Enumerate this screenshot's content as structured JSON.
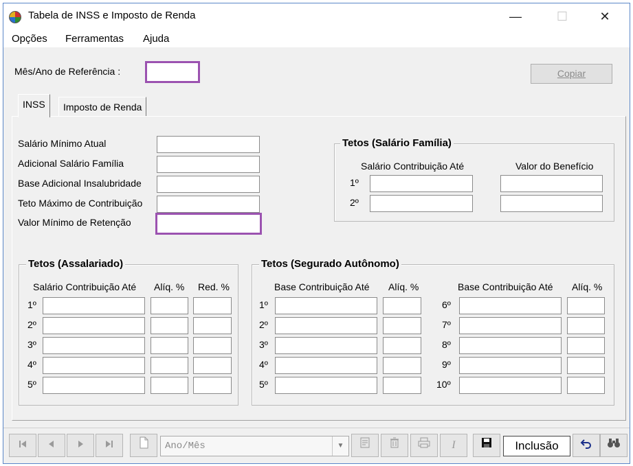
{
  "window": {
    "title": "Tabela de INSS e Imposto de Renda",
    "minimize": "—",
    "maximize": "☐",
    "close": "✕"
  },
  "menu": {
    "opcoes": "Opções",
    "ferramentas": "Ferramentas",
    "ajuda": "Ajuda"
  },
  "header": {
    "ref_label": "Mês/Ano de Referência :",
    "copy_button": "Copiar"
  },
  "tabs": {
    "inss": "INSS",
    "imposto": "Imposto de Renda"
  },
  "inss": {
    "salario_minimo": "Salário Mínimo Atual",
    "adicional_familia": "Adicional Salário Família",
    "base_insalubridade": "Base Adicional Insalubridade",
    "teto_maximo": "Teto Máximo de Contribuição",
    "valor_minimo": "Valor Mínimo de Retenção"
  },
  "familia": {
    "title": "Tetos (Salário Família)",
    "col_salario": "Salário Contribuição Até",
    "col_beneficio": "Valor do Benefício",
    "row1": "1º",
    "row2": "2º"
  },
  "assalariado": {
    "title": "Tetos (Assalariado)",
    "col_salario": "Salário Contribuição Até",
    "col_aliq": "Alíq. %",
    "col_red": "Red. %",
    "rows": [
      "1º",
      "2º",
      "3º",
      "4º",
      "5º"
    ]
  },
  "autonomo": {
    "title": "Tetos (Segurado Autônomo)",
    "col_base": "Base Contribuição Até",
    "col_aliq": "Alíq. %",
    "col_base2": "Base Contribuição Até",
    "col_aliq2": "Alíq. %",
    "rows_left": [
      "1º",
      "2º",
      "3º",
      "4º",
      "5º"
    ],
    "rows_right": [
      "6º",
      "7º",
      "8º",
      "9º",
      "10º"
    ]
  },
  "navbar": {
    "combo_placeholder": "Ano/Mês",
    "status": "Inclusão"
  },
  "colors": {
    "highlight": "#9b52b0",
    "window_border": "#5a86c8"
  }
}
